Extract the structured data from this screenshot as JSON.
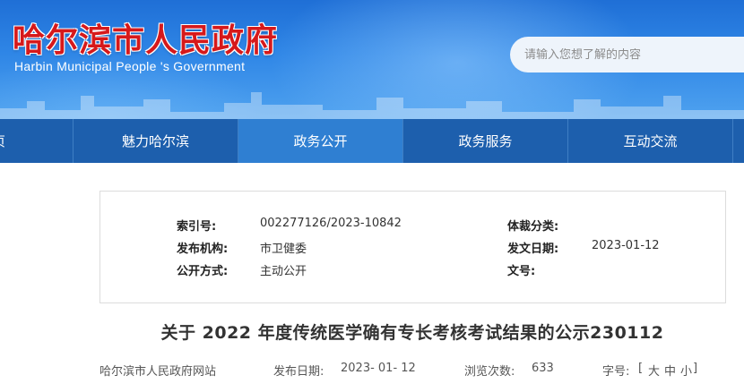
{
  "header": {
    "site_title": "哈尔滨市人民政府",
    "site_subtitle": "Harbin Municipal People 's Government",
    "search_placeholder": "请输入您想了解的内容"
  },
  "nav": {
    "items": [
      {
        "label": "页"
      },
      {
        "label": "魅力哈尔滨"
      },
      {
        "label": "政务公开"
      },
      {
        "label": "政务服务"
      },
      {
        "label": "互动交流"
      }
    ],
    "active_index": 2
  },
  "info": {
    "index_label": "索引号:",
    "index_value": "002277126/2023-10842",
    "genre_label": "体裁分类:",
    "genre_value": "",
    "org_label": "发布机构:",
    "org_value": "市卫健委",
    "date_label": "发文日期:",
    "date_value": "2023-01-12",
    "mode_label": "公开方式:",
    "mode_value": "主动公开",
    "docno_label": "文号:",
    "docno_value": ""
  },
  "article": {
    "title": "关于 2022 年度传统医学确有专长考核考试结果的公示230112",
    "source": "哈尔滨市人民政府网站",
    "pub_date_label": "发布日期:",
    "pub_date_value": "2023- 01- 12",
    "views_label": "浏览次数:",
    "views_value": "633",
    "font_label": "字号:",
    "font_open": "[",
    "font_large": "大",
    "font_medium": "中",
    "font_small": "小",
    "font_close": "]"
  },
  "colors": {
    "banner_blue": "#2f86e6",
    "nav_blue": "#1d5fad",
    "nav_active": "#2f7fd2",
    "title_red": "#d6191b"
  }
}
